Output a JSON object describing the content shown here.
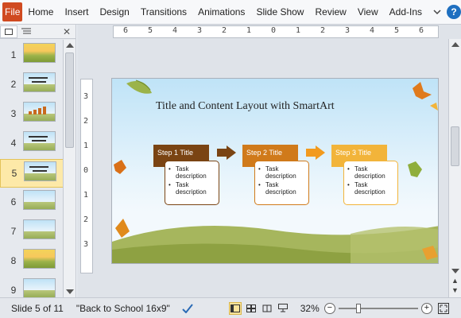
{
  "ribbon": {
    "file_label": "File",
    "tabs": [
      "Home",
      "Insert",
      "Design",
      "Transitions",
      "Animations",
      "Slide Show",
      "Review",
      "View",
      "Add-Ins"
    ],
    "help_label": "?"
  },
  "thumbnails": [
    {
      "number": "1"
    },
    {
      "number": "2"
    },
    {
      "number": "3"
    },
    {
      "number": "4"
    },
    {
      "number": "5",
      "selected": true
    },
    {
      "number": "6"
    },
    {
      "number": "7"
    },
    {
      "number": "8"
    },
    {
      "number": "9"
    }
  ],
  "ruler": {
    "horizontal": [
      "6",
      "5",
      "4",
      "3",
      "2",
      "1",
      "0",
      "1",
      "2",
      "3",
      "4",
      "5",
      "6"
    ],
    "vertical": [
      "3",
      "2",
      "1",
      "0",
      "1",
      "2",
      "3"
    ]
  },
  "slide": {
    "title": "Title and Content Layout with SmartArt",
    "steps": [
      {
        "title": "Step  1 Title",
        "bullets": [
          "Task description",
          "Task description"
        ],
        "color": "#7a4413",
        "arrow_color": "#7a4413"
      },
      {
        "title": "Step  2 Title",
        "bullets": [
          "Task description",
          "Task description"
        ],
        "color": "#d07a1a",
        "arrow_color": "#f29a1e"
      },
      {
        "title": "Step  3 Title",
        "bullets": [
          "Task description",
          "Task description"
        ],
        "color": "#f2b43a"
      }
    ]
  },
  "status": {
    "slide_of": "Slide 5 of 11",
    "theme": "\"Back to School 16x9\"",
    "zoom": "32%",
    "zoom_fraction": 0.32
  }
}
